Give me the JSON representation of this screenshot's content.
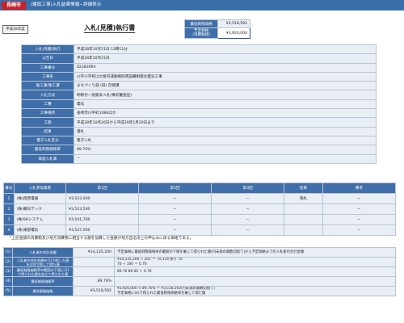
{
  "header": {
    "city": "長崎市",
    "title": "(建設工事)入札結果情報−詳細表示"
  },
  "year_badge": "平成28年度",
  "doc_title": "入札(見積)執行書",
  "price_box": {
    "min_price_label": "最低制限価格",
    "min_price_value": "¥3,518,592",
    "estimate_label": "予定価格\n(消費税抜)",
    "estimate_value": "¥3,920,000"
  },
  "info_rows": [
    {
      "label": "入札(見積)執行",
      "value": "平成28年10月21日 13時11分"
    },
    {
      "label": "公告日",
      "value": "平成28年10月21日"
    },
    {
      "label": "工事番号",
      "value": "02283094"
    },
    {
      "label": "工事名",
      "value": "川平小学校ほか屋内運動場照明設備耐震化電気工事"
    },
    {
      "label": "施工課/施工課",
      "value": "まちづくり部 (旧) 営繕課"
    },
    {
      "label": "入札方式",
      "value": "制限付一般競争入札(事前審査型)"
    },
    {
      "label": "工種",
      "value": "電気"
    },
    {
      "label": "工事場所",
      "value": "長崎市川平町1088ほか"
    },
    {
      "label": "工期",
      "value": "平成28年10月26日から平成29年1月20日まで"
    },
    {
      "label": "結果",
      "value": "落札"
    },
    {
      "label": "電子入札区分",
      "value": "電子入札"
    },
    {
      "label": "最低制限価格率",
      "value": "89.76%"
    },
    {
      "label": "辞退入札率",
      "value": "−"
    }
  ],
  "bid_table": {
    "headers": [
      "番号",
      "入札参加業者",
      "第1回",
      "第2回",
      "第3回",
      "結果",
      "備考"
    ],
    "rows": [
      {
        "no": "1",
        "company": "(株)南西電通",
        "r1": "¥3,523,000",
        "r2": "−",
        "r3": "−",
        "result": "落札",
        "note": "−"
      },
      {
        "no": "2",
        "company": "(株)朝日テック",
        "r1": "¥3,523,500",
        "r2": "−",
        "r3": "−",
        "result": "",
        "note": "−"
      },
      {
        "no": "3",
        "company": "(株)SKシステム",
        "r1": "¥3,541,700",
        "r2": "−",
        "r3": "−",
        "result": "",
        "note": "−"
      },
      {
        "no": "4",
        "company": "(株)東部電気",
        "r1": "¥3,547,000",
        "r2": "−",
        "r3": "−",
        "result": "",
        "note": "−"
      }
    ]
  },
  "note": "*上記金額の消費税及び地方消費税に相当する額を加算した金額が地方自治法上の申込みに係る価格である。",
  "calc_rows": [
    {
      "no": "(1)",
      "label": "入札者の合計金額",
      "amount": "¥14,135,200",
      "desc": "予定価格に最低制限価格率の範囲の下限を乗じて得られた額(円未満の端数切捨て)から予定価格までの入札者の合計金額"
    },
    {
      "no": "(2)",
      "label": "入札者の合計金額を(1)で除した値を100で除して得た値",
      "amount": "",
      "desc": "¥14,135,200 ÷ 201 ＝ 70,324 余り 76\n76 ÷ 100 ＝ 0.76"
    },
    {
      "no": "(3)",
      "label": "最低制限価格率の範囲の下限に(2)で得られた値を加えて得られた値",
      "amount": "",
      "desc": "89.76 89.00 ＋ 0.76"
    },
    {
      "no": "(4)",
      "label": "最低制限価格率",
      "amount": "89.76%",
      "desc": ""
    },
    {
      "no": "(5)",
      "label": "最低制限価格",
      "amount": "¥3,518,592",
      "desc": "¥3,920,000 × 89.76% ＝ ¥3,518,592(円未満の端数切捨て)\n予定価格に(4)で得られた最低制限価格率を乗じて得た額"
    }
  ],
  "colors": {
    "header_bg": "#3a6fa8",
    "city_bg": "#c8222b",
    "label_bg": "#3f6ea8",
    "value_bg": "#e9eef5"
  }
}
